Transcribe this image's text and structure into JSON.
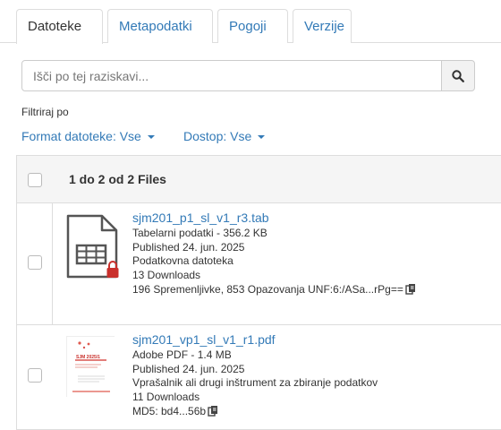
{
  "tabs": [
    {
      "label": "Datoteke",
      "active": true
    },
    {
      "label": "Metapodatki",
      "active": false
    },
    {
      "label": "Pogoji",
      "active": false
    },
    {
      "label": "Verzije",
      "active": false
    }
  ],
  "search": {
    "placeholder": "Išči po tej raziskavi..."
  },
  "filter": {
    "label": "Filtriraj po",
    "format": "Format datoteke: Vse",
    "access": "Dostop: Vse"
  },
  "table": {
    "header": "1 do 2 od 2 Files",
    "files": [
      {
        "name": "sjm201_p1_sl_v1_r3.tab",
        "type": "Tabelarni podatki - 356.2 KB",
        "published": "Published 24. jun. 2025",
        "description": "Podatkovna datoteka",
        "downloads": "13 Downloads",
        "extra": "196 Spremenljivke, 853 Opazovanja UNF:6:/ASa...rPg==",
        "icon": "tabular-file-locked-icon"
      },
      {
        "name": "sjm201_vp1_sl_v1_r1.pdf",
        "type": "Adobe PDF - 1.4 MB",
        "published": "Published 24. jun. 2025",
        "description": "Vprašalnik ali drugi inštrument za zbiranje podatkov",
        "downloads": "11 Downloads",
        "extra": "MD5: bd4...56b",
        "icon": "pdf-thumbnail",
        "thumbnail_text": "SJM 2025/1"
      }
    ]
  },
  "colors": {
    "link": "#337ab7",
    "text": "#333333",
    "border": "#dddddd",
    "header_bg": "#f5f5f5",
    "lock": "#c9302c"
  }
}
